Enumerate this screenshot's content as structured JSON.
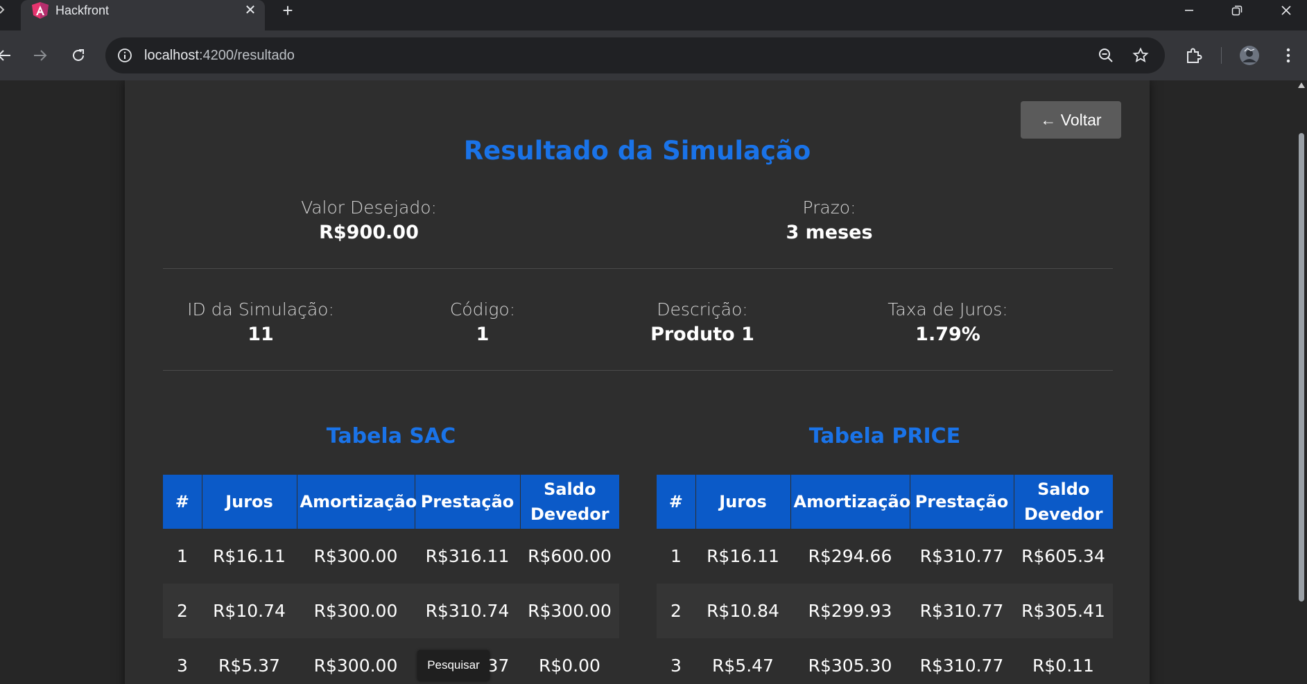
{
  "browser": {
    "tab_title": "Hackfront",
    "url_host": "localhost",
    "url_path": ":4200/resultado"
  },
  "page": {
    "back_label": "← Voltar",
    "title": "Resultado da Simulação",
    "tooltip": "Pesquisar"
  },
  "summary": {
    "valor_label": "Valor Desejado:",
    "valor_value": "R$900.00",
    "prazo_label": "Prazo:",
    "prazo_value": "3 meses"
  },
  "details": {
    "id_label": "ID da Simulação:",
    "id_value": "11",
    "codigo_label": "Código:",
    "codigo_value": "1",
    "descricao_label": "Descrição:",
    "descricao_value": "Produto 1",
    "taxa_label": "Taxa de Juros:",
    "taxa_value": "1.79%"
  },
  "tables": {
    "headers": [
      "#",
      "Juros",
      "Amortização",
      "Prestação",
      "Saldo Devedor"
    ],
    "sac": {
      "title": "Tabela SAC",
      "rows": [
        [
          "1",
          "R$16.11",
          "R$300.00",
          "R$316.11",
          "R$600.00"
        ],
        [
          "2",
          "R$10.74",
          "R$300.00",
          "R$310.74",
          "R$300.00"
        ],
        [
          "3",
          "R$5.37",
          "R$300.00",
          "R$305.37",
          "R$0.00"
        ]
      ]
    },
    "price": {
      "title": "Tabela PRICE",
      "rows": [
        [
          "1",
          "R$16.11",
          "R$294.66",
          "R$310.77",
          "R$605.34"
        ],
        [
          "2",
          "R$10.84",
          "R$299.93",
          "R$310.77",
          "R$305.41"
        ],
        [
          "3",
          "R$5.47",
          "R$305.30",
          "R$310.77",
          "R$0.11"
        ]
      ]
    }
  },
  "colors": {
    "accent": "#1a73e8",
    "table_header": "#0b5ac8",
    "card": "#2e2e2e",
    "background": "#262626"
  },
  "icons": {
    "favicon": "angular-icon",
    "tab_close": "close-icon",
    "new_tab": "plus-icon",
    "back": "arrow-left-icon",
    "forward": "arrow-right-icon",
    "reload": "reload-icon",
    "site_info": "info-icon",
    "zoom": "zoom-out-icon",
    "bookmark": "star-icon",
    "extensions": "puzzle-icon",
    "profile": "avatar",
    "menu": "kebab-menu-icon"
  }
}
